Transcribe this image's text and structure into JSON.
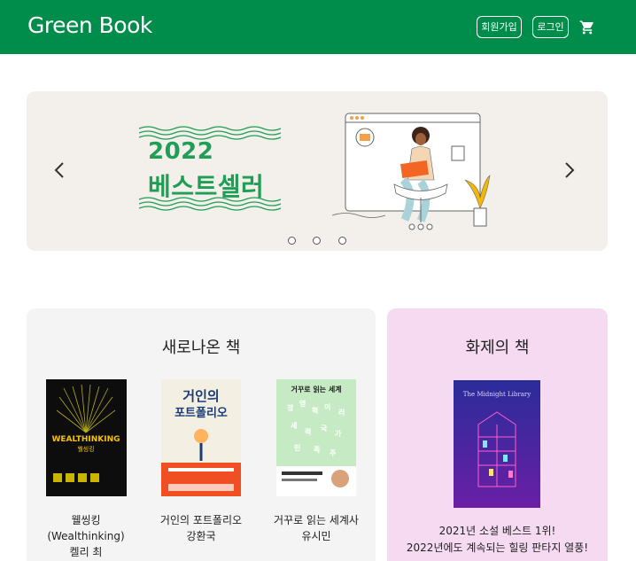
{
  "header": {
    "logo": "Green Book",
    "signup_label": "회원가입",
    "login_label": "로그인",
    "cart_icon": "shopping-cart-icon",
    "bg_color": "#008d4c"
  },
  "carousel": {
    "banner_year": "2022",
    "banner_title": "베스트셀러",
    "accent_color": "#1f9e55",
    "slide_count": 3,
    "left_icon": "chevron-left-icon",
    "right_icon": "chevron-right-icon"
  },
  "new_books": {
    "title": "새로나온 책",
    "items": [
      {
        "title": "웰씽킹\n(Wealthinking)\n켈리 최",
        "cover_text": "WEALTHINKING",
        "cover_sub": "웰씽킹"
      },
      {
        "title": "거인의 포트폴리오\n강환국",
        "cover_text": "거인의\n포트폴리오"
      },
      {
        "title": "거꾸로 읽는 세계사\n유시민",
        "cover_text": "거꾸로 읽는 세계사"
      }
    ]
  },
  "hot_books": {
    "title": "화제의 책",
    "cover_text": "The Midnight Library",
    "description_line1": "2021년 소설 베스트 1위!",
    "description_line2": "2022년에도 계속되는 힐링 판타지 열풍!"
  }
}
